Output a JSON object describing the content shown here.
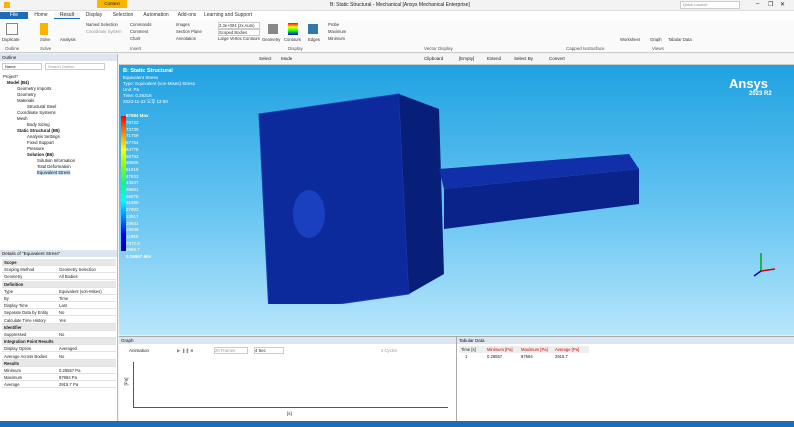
{
  "window": {
    "title": "B: Static Structural - Mechanical [Ansys Mechanical Enterprise]",
    "context_tab": "Context",
    "search_placeholder": "Quick Launch"
  },
  "tabs": [
    "File",
    "Home",
    "Result",
    "Display",
    "Selection",
    "Automation",
    "Add-ons",
    "Learning and Support"
  ],
  "ribbon": {
    "outline_label": "Outline",
    "solve_label": "Solve",
    "insert_label": "Insert",
    "display_label": "Display",
    "vector_label": "Vector Display",
    "capped_label": "Capped IsoSurface",
    "views_label": "Views",
    "duplicate": "Duplicate",
    "solve": "Solve",
    "analysis": "Analysis",
    "named_selection": "Named Selection",
    "commands": "Commands",
    "images": "Images",
    "coordinate_system": "Coordinate System",
    "comment": "Comment",
    "section_plane": "Section Plane",
    "chart": "Chart",
    "annotation": "Annotation",
    "scale": "3.3e+004 (2x Auto)",
    "scoped_bodies": "Scoped Bodies",
    "vertex_contours": "Large Vertex Contours",
    "geometry": "Geometry",
    "contours": "Contours",
    "edges": "Edges",
    "probe": "Probe",
    "maximum": "Maximum",
    "minimum": "Minimum",
    "graph": "Graph",
    "tabular_data": "Tabular Data",
    "worksheet": "Worksheet"
  },
  "outline": {
    "title": "Outline",
    "name_filter": "Name",
    "search_placeholder": "Search Outline",
    "items": [
      "Project*",
      "Model (B4)",
      "Geometry Imports",
      "Geometry",
      "Materials",
      "Structural Steel",
      "Coordinate Systems",
      "Mesh",
      "Body Sizing",
      "Static Structural (B5)",
      "Analysis Settings",
      "Fixed Support",
      "Pressure",
      "Solution (B6)",
      "Solution Information",
      "Total Deformation",
      "Equivalent Stress"
    ]
  },
  "details": {
    "title": "Details of \"Equivalent Stress\"",
    "rows": [
      [
        "Scope",
        ""
      ],
      [
        "Scoping Method",
        "Geometry Selection"
      ],
      [
        "Geometry",
        "All Bodies"
      ],
      [
        "Definition",
        ""
      ],
      [
        "Type",
        "Equivalent (von-Mises)"
      ],
      [
        "By",
        "Time"
      ],
      [
        "Display Time",
        "Last"
      ],
      [
        "Separate Data by Entity",
        "No"
      ],
      [
        "Calculate Time History",
        "Yes"
      ],
      [
        "Identifier",
        ""
      ],
      [
        "Suppressed",
        "No"
      ],
      [
        "Integration Point Results",
        ""
      ],
      [
        "Display Option",
        "Averaged"
      ],
      [
        "Average Across Bodies",
        "No"
      ],
      [
        "Results",
        ""
      ],
      [
        "Minimum",
        "0.26557 Pa"
      ],
      [
        "Maximum",
        "87684 Pa"
      ],
      [
        "Average",
        "2915.7 Pa"
      ]
    ]
  },
  "viewport": {
    "title": "B: Static Structural",
    "result": "Equivalent Stress",
    "type": "Type: Equivalent (von-Mises) Stress",
    "unit": "Unit: Pa",
    "time": "Time: 0.26316",
    "date": "2023-11-22 오후 12:08",
    "max_label": "87684 Max",
    "min_label": "0.26557 Min",
    "legend": [
      "78722",
      "73739",
      "71759",
      "67764",
      "63778",
      "58792",
      "55806",
      "51819",
      "47833",
      "43847",
      "39861",
      "35875",
      "31889",
      "27903",
      "23917",
      "19931",
      "15946",
      "11959",
      "7972.9",
      "3986.7"
    ],
    "brand": "Ansys",
    "version": "2023 R2",
    "clipboard": "Clipboard",
    "empty": "[Empty]",
    "extend": "Extend",
    "select_by": "Select By",
    "convert": "Convert",
    "select": "Select",
    "mode": "Mode"
  },
  "graph": {
    "title": "Graph",
    "animation": "Animation",
    "frames": "20 Frames",
    "duration": "4 Sec",
    "cycles": "3 Cycles",
    "y_label": "[Pa]",
    "x_label": "[s]"
  },
  "tabular": {
    "title": "Tabular Data",
    "headers": [
      "Time [s]",
      "Minimum [Pa]",
      "Maximum [Pa]",
      "Average [Pa]"
    ],
    "row": [
      "1",
      "0.26557",
      "87684",
      "2915.7"
    ]
  },
  "colors": {
    "accent": "#1e6bb8",
    "contour_max": "#ff0000",
    "contour_min": "#0000aa"
  }
}
